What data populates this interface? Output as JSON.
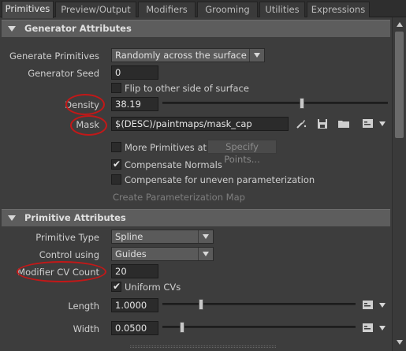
{
  "tabs": [
    "Primitives",
    "Preview/Output",
    "Modifiers",
    "Grooming",
    "Utilities",
    "Expressions"
  ],
  "generator": {
    "title": "Generator Attributes",
    "generate_primitives_label": "Generate Primitives",
    "generate_primitives_value": "Randomly across the surface",
    "generator_seed_label": "Generator Seed",
    "generator_seed_value": "0",
    "flip_label": "Flip to other side of surface",
    "flip_checked": false,
    "density_label": "Density",
    "density_value": "38.19",
    "density_slider_fraction": 0.62,
    "mask_label": "Mask",
    "mask_value": "$(DESC)/paintmaps/mask_cap",
    "more_primitives_label": "More Primitives at",
    "more_primitives_checked": false,
    "specify_points_label": "Specify Points...",
    "compensate_normals_label": "Compensate Normals",
    "compensate_normals_checked": true,
    "compensate_uneven_label": "Compensate for uneven parameterization",
    "compensate_uneven_checked": false,
    "create_param_map_label": "Create Parameterization Map"
  },
  "primitive": {
    "title": "Primitive Attributes",
    "primitive_type_label": "Primitive Type",
    "primitive_type_value": "Spline",
    "control_using_label": "Control using",
    "control_using_value": "Guides",
    "cv_count_label": "Modifier CV Count",
    "cv_count_value": "20",
    "uniform_cvs_label": "Uniform CVs",
    "uniform_cvs_checked": true,
    "length_label": "Length",
    "length_value": "1.0000",
    "length_slider_fraction": 0.2,
    "width_label": "Width",
    "width_value": "0.0500",
    "width_slider_fraction": 0.1
  },
  "icons": [
    "paint-brush-icon",
    "save-icon",
    "folder-icon",
    "expression-icon",
    "dropdown-arrow-icon"
  ],
  "colors": {
    "annotation_red": "#c21818",
    "panel_bg": "#3d3d3d",
    "section_header": "#5d5d5d"
  }
}
